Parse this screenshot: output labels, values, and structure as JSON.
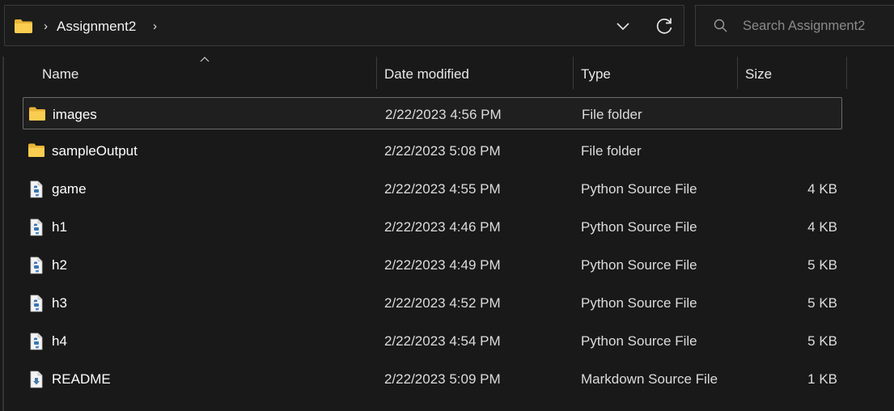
{
  "address": {
    "folder_icon": "folder-icon",
    "separator": "›",
    "crumb": "Assignment2",
    "trailing_separator": "›"
  },
  "search": {
    "placeholder": "Search Assignment2"
  },
  "columns": {
    "name": "Name",
    "date": "Date modified",
    "type": "Type",
    "size": "Size",
    "sort": "ascending"
  },
  "files": [
    {
      "name": "images",
      "date": "2/22/2023 4:56 PM",
      "type": "File folder",
      "size": "",
      "icon": "folder-icon",
      "selected": true
    },
    {
      "name": "sampleOutput",
      "date": "2/22/2023 5:08 PM",
      "type": "File folder",
      "size": "",
      "icon": "folder-icon",
      "selected": false
    },
    {
      "name": "game",
      "date": "2/22/2023 4:55 PM",
      "type": "Python Source File",
      "size": "4 KB",
      "icon": "python-file-icon",
      "selected": false
    },
    {
      "name": "h1",
      "date": "2/22/2023 4:46 PM",
      "type": "Python Source File",
      "size": "4 KB",
      "icon": "python-file-icon",
      "selected": false
    },
    {
      "name": "h2",
      "date": "2/22/2023 4:49 PM",
      "type": "Python Source File",
      "size": "5 KB",
      "icon": "python-file-icon",
      "selected": false
    },
    {
      "name": "h3",
      "date": "2/22/2023 4:52 PM",
      "type": "Python Source File",
      "size": "5 KB",
      "icon": "python-file-icon",
      "selected": false
    },
    {
      "name": "h4",
      "date": "2/22/2023 4:54 PM",
      "type": "Python Source File",
      "size": "5 KB",
      "icon": "python-file-icon",
      "selected": false
    },
    {
      "name": "README",
      "date": "2/22/2023 5:09 PM",
      "type": "Markdown Source File",
      "size": "1 KB",
      "icon": "markdown-file-icon",
      "selected": false
    }
  ]
}
